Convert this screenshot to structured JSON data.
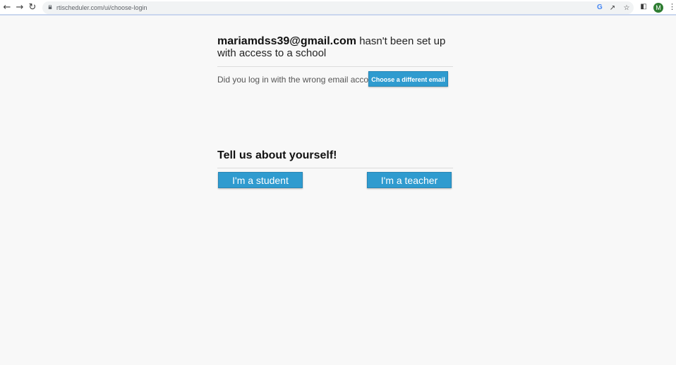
{
  "browser": {
    "url": "rtischeduler.com/ui/choose-login",
    "back_icon": "arrow-left-icon",
    "forward_icon": "arrow-right-icon",
    "reload_icon": "reload-icon",
    "lock_icon": "lock-icon",
    "google_icon": "google-g-icon",
    "google_letter": "G",
    "share_icon": "share-icon",
    "star_icon": "star-icon",
    "sidebar_icon": "side-panel-icon",
    "avatar_letter": "M",
    "avatar_color": "#2e7d32",
    "menu_icon": "more-vert-icon"
  },
  "main": {
    "email": "mariamdss39@gmail.com",
    "headline_rest": " hasn't been set up with access to a school",
    "wrong_account_text": "Did you log in with the wrong email account?",
    "choose_email_label": "Choose a different email",
    "tell_title": "Tell us about yourself!",
    "student_label": "I'm a student",
    "teacher_label": "I'm a teacher",
    "accent_color": "#2f9bcf"
  }
}
